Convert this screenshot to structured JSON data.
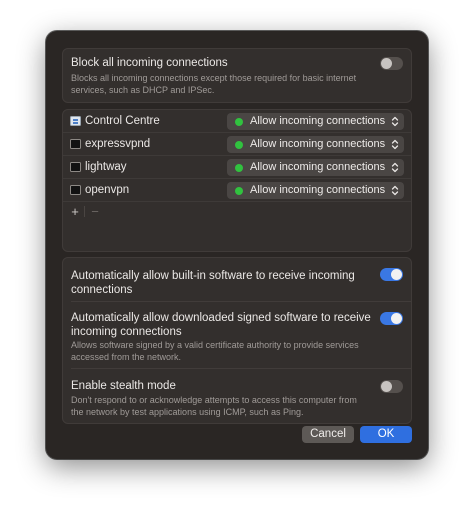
{
  "block_all": {
    "title": "Block all incoming connections",
    "description": "Blocks all incoming connections except those required for basic internet services, such as DHCP and IPSec.",
    "enabled": false
  },
  "apps": [
    {
      "name": "Control Centre",
      "icon": "control-centre-icon",
      "policy": "Allow incoming connections"
    },
    {
      "name": "expressvpnd",
      "icon": "terminal-icon",
      "policy": "Allow incoming connections"
    },
    {
      "name": "lightway",
      "icon": "terminal-icon",
      "policy": "Allow incoming connections"
    },
    {
      "name": "openvpn",
      "icon": "terminal-icon",
      "policy": "Allow incoming connections"
    }
  ],
  "list_controls": {
    "add": "+",
    "remove": "−"
  },
  "options": {
    "builtin": {
      "title": "Automatically allow built-in software to receive incoming connections",
      "enabled": true
    },
    "signed": {
      "title": "Automatically allow downloaded signed software to receive incoming connections",
      "description": "Allows software signed by a valid certificate authority to provide services accessed from the network.",
      "enabled": true
    },
    "stealth": {
      "title": "Enable stealth mode",
      "description": "Don't respond to or acknowledge attempts to access this computer from the network by test applications using ICMP, such as Ping.",
      "enabled": false
    }
  },
  "buttons": {
    "cancel": "Cancel",
    "ok": "OK"
  },
  "colors": {
    "accent": "#2f6fe0",
    "toggle_on": "#3a78e4",
    "status_allow": "#31c23f"
  }
}
